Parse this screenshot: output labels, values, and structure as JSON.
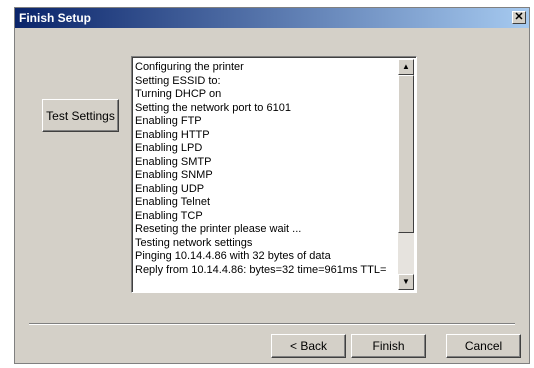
{
  "window": {
    "title": "Finish Setup",
    "close_glyph": "✕"
  },
  "buttons": {
    "test_settings": "Test Settings",
    "back": "< Back",
    "finish": "Finish",
    "cancel": "Cancel"
  },
  "log_lines": [
    "Configuring the printer",
    "Setting ESSID to:",
    "Turning DHCP on",
    "Setting the network port to 6101",
    "Enabling FTP",
    "Enabling HTTP",
    "Enabling LPD",
    "Enabling SMTP",
    "Enabling SNMP",
    "Enabling UDP",
    "Enabling Telnet",
    "Enabling TCP",
    "Reseting the printer please wait ...",
    "Testing network settings",
    "Pinging 10.14.4.86 with 32 bytes of data",
    "Reply from 10.14.4.86: bytes=32 time=961ms TTL="
  ],
  "scrollbar": {
    "up_icon": "▲",
    "down_icon": "▼"
  }
}
